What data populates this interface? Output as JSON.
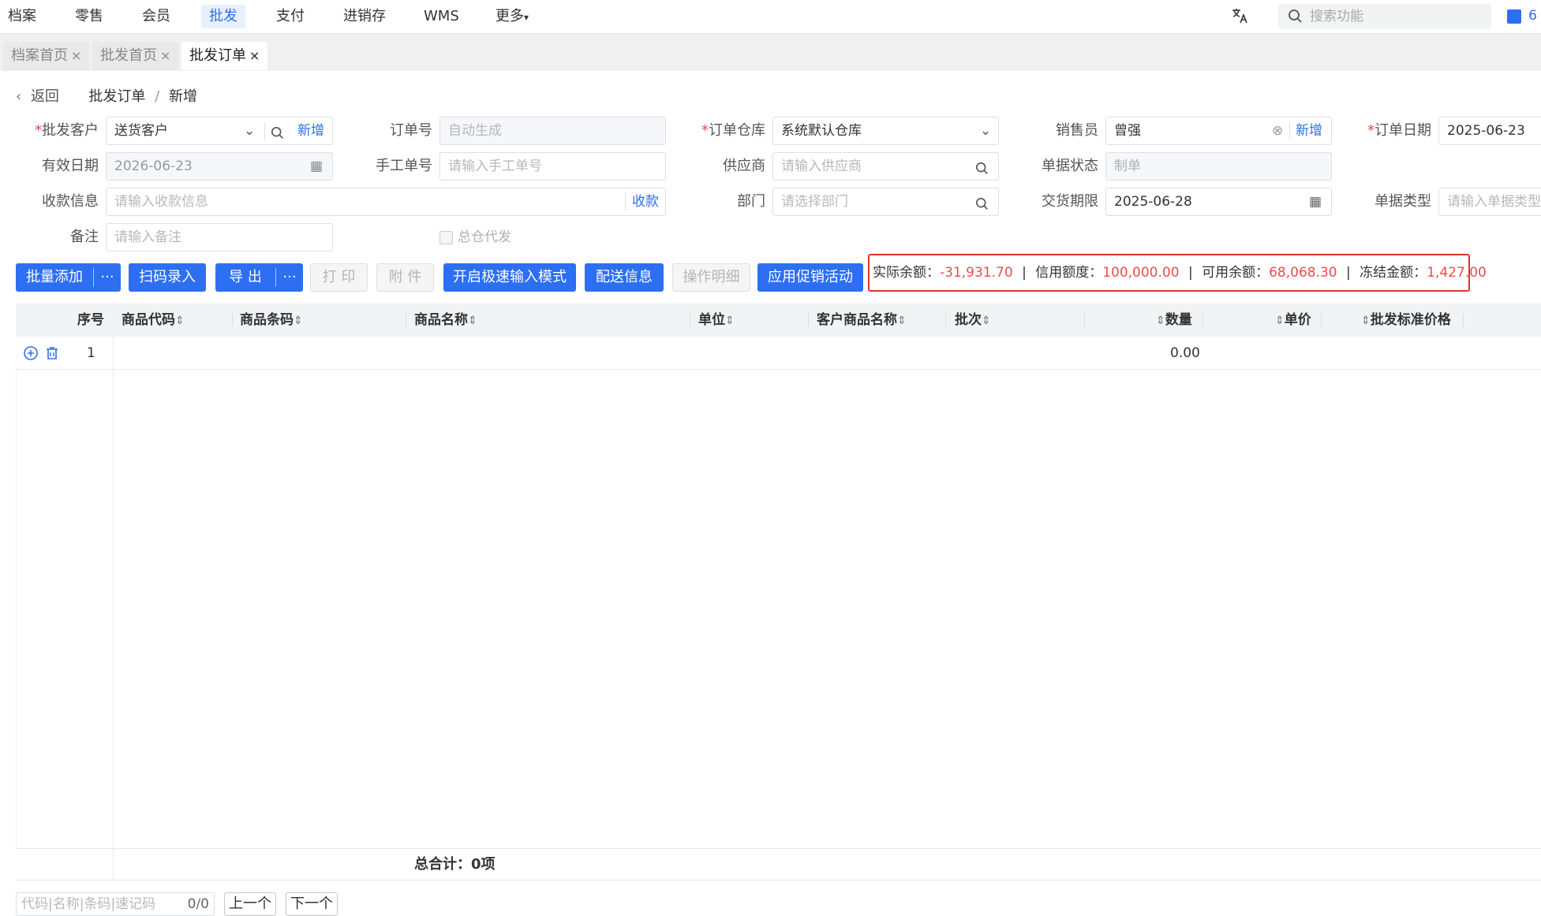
{
  "nav": {
    "items": [
      "档案",
      "零售",
      "会员",
      "批发",
      "支付",
      "进销存",
      "WMS",
      "更多"
    ],
    "active": "批发",
    "search_placeholder": "搜索功能",
    "user_fragment": "6"
  },
  "tabs": [
    {
      "label": "档案首页",
      "close": "×"
    },
    {
      "label": "批发首页",
      "close": "×"
    },
    {
      "label": "批发订单",
      "close": "×"
    }
  ],
  "breadcrumb": {
    "back": "返回",
    "parent": "批发订单",
    "sep": "/",
    "current": "新增"
  },
  "form": {
    "customer": {
      "label": "批发客户",
      "value": "送货客户",
      "add": "新增"
    },
    "order_no": {
      "label": "订单号",
      "placeholder": "自动生成"
    },
    "warehouse": {
      "label": "订单仓库",
      "value": "系统默认仓库"
    },
    "salesman": {
      "label": "销售员",
      "value": "曾强",
      "add": "新增"
    },
    "order_date": {
      "label": "订单日期",
      "value": "2025-06-23"
    },
    "valid_date": {
      "label": "有效日期",
      "value": "2026-06-23"
    },
    "manual_no": {
      "label": "手工单号",
      "placeholder": "请输入手工单号"
    },
    "supplier": {
      "label": "供应商",
      "placeholder": "请输入供应商"
    },
    "status": {
      "label": "单据状态",
      "value": "制单"
    },
    "payment": {
      "label": "收款信息",
      "placeholder": "请输入收款信息",
      "action": "收款"
    },
    "dept": {
      "label": "部门",
      "placeholder": "请选择部门"
    },
    "delivery": {
      "label": "交货期限",
      "value": "2025-06-28"
    },
    "doc_type": {
      "label": "单据类型",
      "placeholder": "请输入单据类型"
    },
    "remark": {
      "label": "备注",
      "placeholder": "请输入备注"
    },
    "consign": {
      "label": "总仓代发"
    }
  },
  "toolbar": {
    "batch_add": "批量添加",
    "more": "···",
    "scan": "扫码录入",
    "export": "导 出",
    "print": "打 印",
    "attach": "附 件",
    "fast_mode": "开启极速输入模式",
    "delivery_info": "配送信息",
    "op_detail": "操作明细",
    "promo": "应用促销活动"
  },
  "balance": {
    "actual_label": "实际余额：",
    "actual": "-31,931.70",
    "credit_label": "信用额度：",
    "credit": "100,000.00",
    "available_label": "可用余额：",
    "available": "68,068.30",
    "frozen_label": "冻结金额：",
    "frozen": "1,427.00",
    "sep": "|"
  },
  "table": {
    "headers": {
      "seq": "序号",
      "code": "商品代码",
      "barcode": "商品条码",
      "name": "商品名称",
      "unit": "单位",
      "cust_name": "客户商品名称",
      "batch": "批次",
      "qty": "数量",
      "price": "单价",
      "std_price": "批发标准价格"
    },
    "rows": [
      {
        "seq": "1",
        "qty": "0.00"
      }
    ],
    "total": "总合计：0项"
  },
  "pager": {
    "placeholder": "代码|名称|条码|速记码",
    "counter": "0/0",
    "prev": "上一个",
    "next": "下一个"
  },
  "colors": {
    "accent": "#2d6ff2",
    "danger": "#f04a4a",
    "highlight_border": "#e0332b"
  }
}
